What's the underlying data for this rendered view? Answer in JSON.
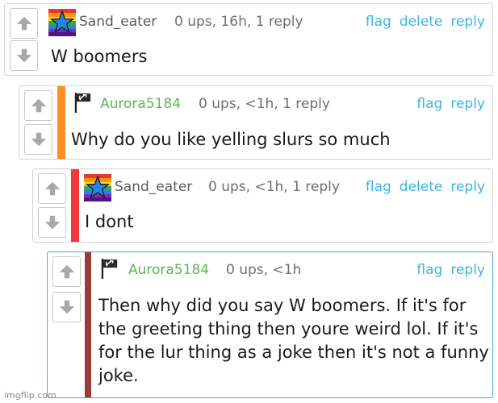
{
  "colors": {
    "link": "#3bb6e2",
    "username_green": "#5cb45a",
    "username_gray": "#5a5a5a",
    "depth_orange": "#ff8f1f",
    "depth_red": "#f0393a",
    "depth_maroon": "#9a3b3b",
    "active_border": "#4aa8dc"
  },
  "comments": [
    {
      "username": "Sand_eater",
      "meta": "0 ups, 16h, 1 reply",
      "actions": {
        "flag": "flag",
        "delete": "delete",
        "reply": "reply"
      },
      "text": "W boomers",
      "avatar_icon": "rainbow-star-icon"
    },
    {
      "username": "Aurora5184",
      "meta": "0 ups, <1h, 1 reply",
      "actions": {
        "flag": "flag",
        "reply": "reply"
      },
      "text": "Why do you like yelling slurs so much",
      "avatar_icon": "hammer-sickle-flag-icon"
    },
    {
      "username": "Sand_eater",
      "meta": "0 ups, <1h, 1 reply",
      "actions": {
        "flag": "flag",
        "delete": "delete",
        "reply": "reply"
      },
      "text": "I dont",
      "avatar_icon": "rainbow-star-icon"
    },
    {
      "username": "Aurora5184",
      "meta": "0 ups, <1h",
      "actions": {
        "flag": "flag",
        "reply": "reply"
      },
      "text": "Then why did you say W boomers. If it's for the greeting thing then youre weird lol. If it's for the lur thing as a joke then it's not a funny joke.",
      "avatar_icon": "hammer-sickle-flag-icon"
    }
  ],
  "watermark": "imgflip.com"
}
